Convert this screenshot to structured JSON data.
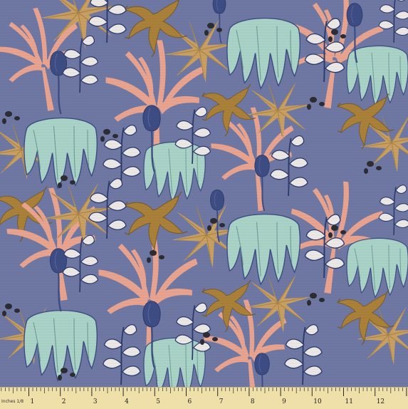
{
  "product": {
    "kind": "fabric swatch",
    "pattern_motifs": [
      "coral-branch",
      "willow-leaf-cluster",
      "blue-bud",
      "white-leaf-sprig",
      "dried-fern"
    ],
    "colors": {
      "background": "#6f78a3",
      "coral_pink": "#e9a48f",
      "mustard": "#c9a062",
      "mint": "#a9d3c7",
      "navy": "#3d4d84",
      "leaf_white": "#ece8e6",
      "dark_spot": "#2c2c33",
      "ochre_fern": "#a9813a",
      "ruler_tan": "#efdfa9"
    }
  },
  "ruler": {
    "units_label": "Inches 1/8",
    "tick_labels": [
      "1",
      "2",
      "3",
      "4",
      "5",
      "6",
      "7",
      "8",
      "9",
      "10",
      "11",
      "12"
    ]
  }
}
